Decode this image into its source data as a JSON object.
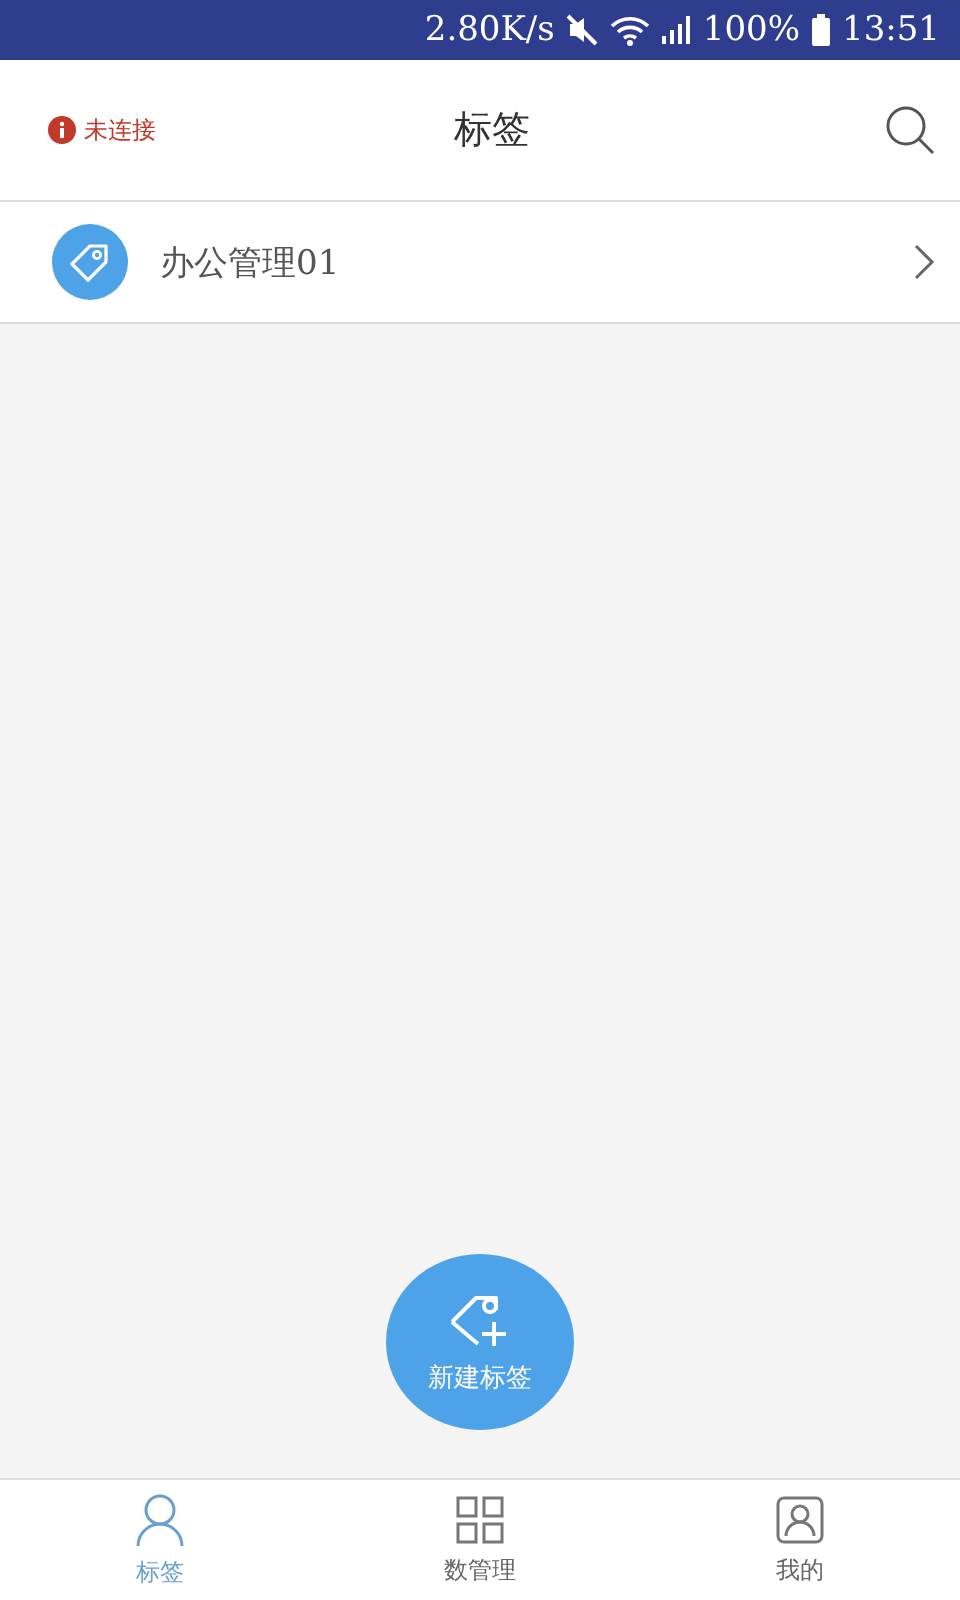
{
  "status_bar": {
    "speed": "2.80K/s",
    "battery": "100%",
    "time": "13:51"
  },
  "header": {
    "connection": "未连接",
    "title": "标签"
  },
  "tags": [
    {
      "name": "办公管理01"
    }
  ],
  "fab": {
    "label": "新建标签"
  },
  "bottom_nav": [
    {
      "label": "标签",
      "selected": true,
      "kind": "person"
    },
    {
      "label": "数管理",
      "selected": false,
      "kind": "grid"
    },
    {
      "label": "我的",
      "selected": false,
      "kind": "profile"
    }
  ]
}
